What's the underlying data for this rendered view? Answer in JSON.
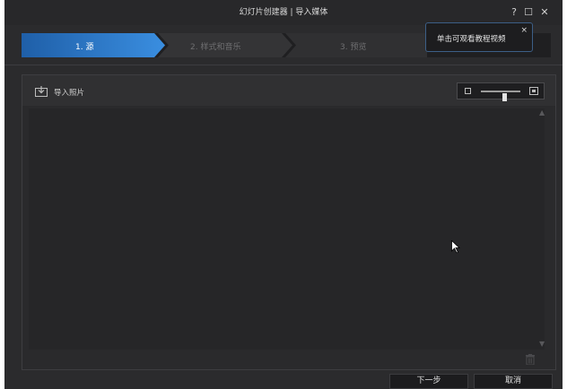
{
  "window": {
    "title": "幻灯片创建器 | 导入媒体",
    "help": "?",
    "maximize": "☐",
    "close": "✕"
  },
  "steps": [
    {
      "label": "1. 源",
      "active": true
    },
    {
      "label": "2. 样式和音乐",
      "active": false
    },
    {
      "label": "3. 预览",
      "active": false
    }
  ],
  "tooltip": {
    "text": "单击可观看教程视频",
    "close": "×"
  },
  "panel": {
    "import_label": "导入照片",
    "zoom_level": 0.6,
    "scroll_up": "▲",
    "scroll_down": "▼"
  },
  "footer": {
    "next_label": "下一步",
    "cancel_label": "取消"
  },
  "colors": {
    "active_step": "#2f7fd0",
    "inactive_step": "#343436",
    "tooltip_border": "#3c5e86"
  }
}
